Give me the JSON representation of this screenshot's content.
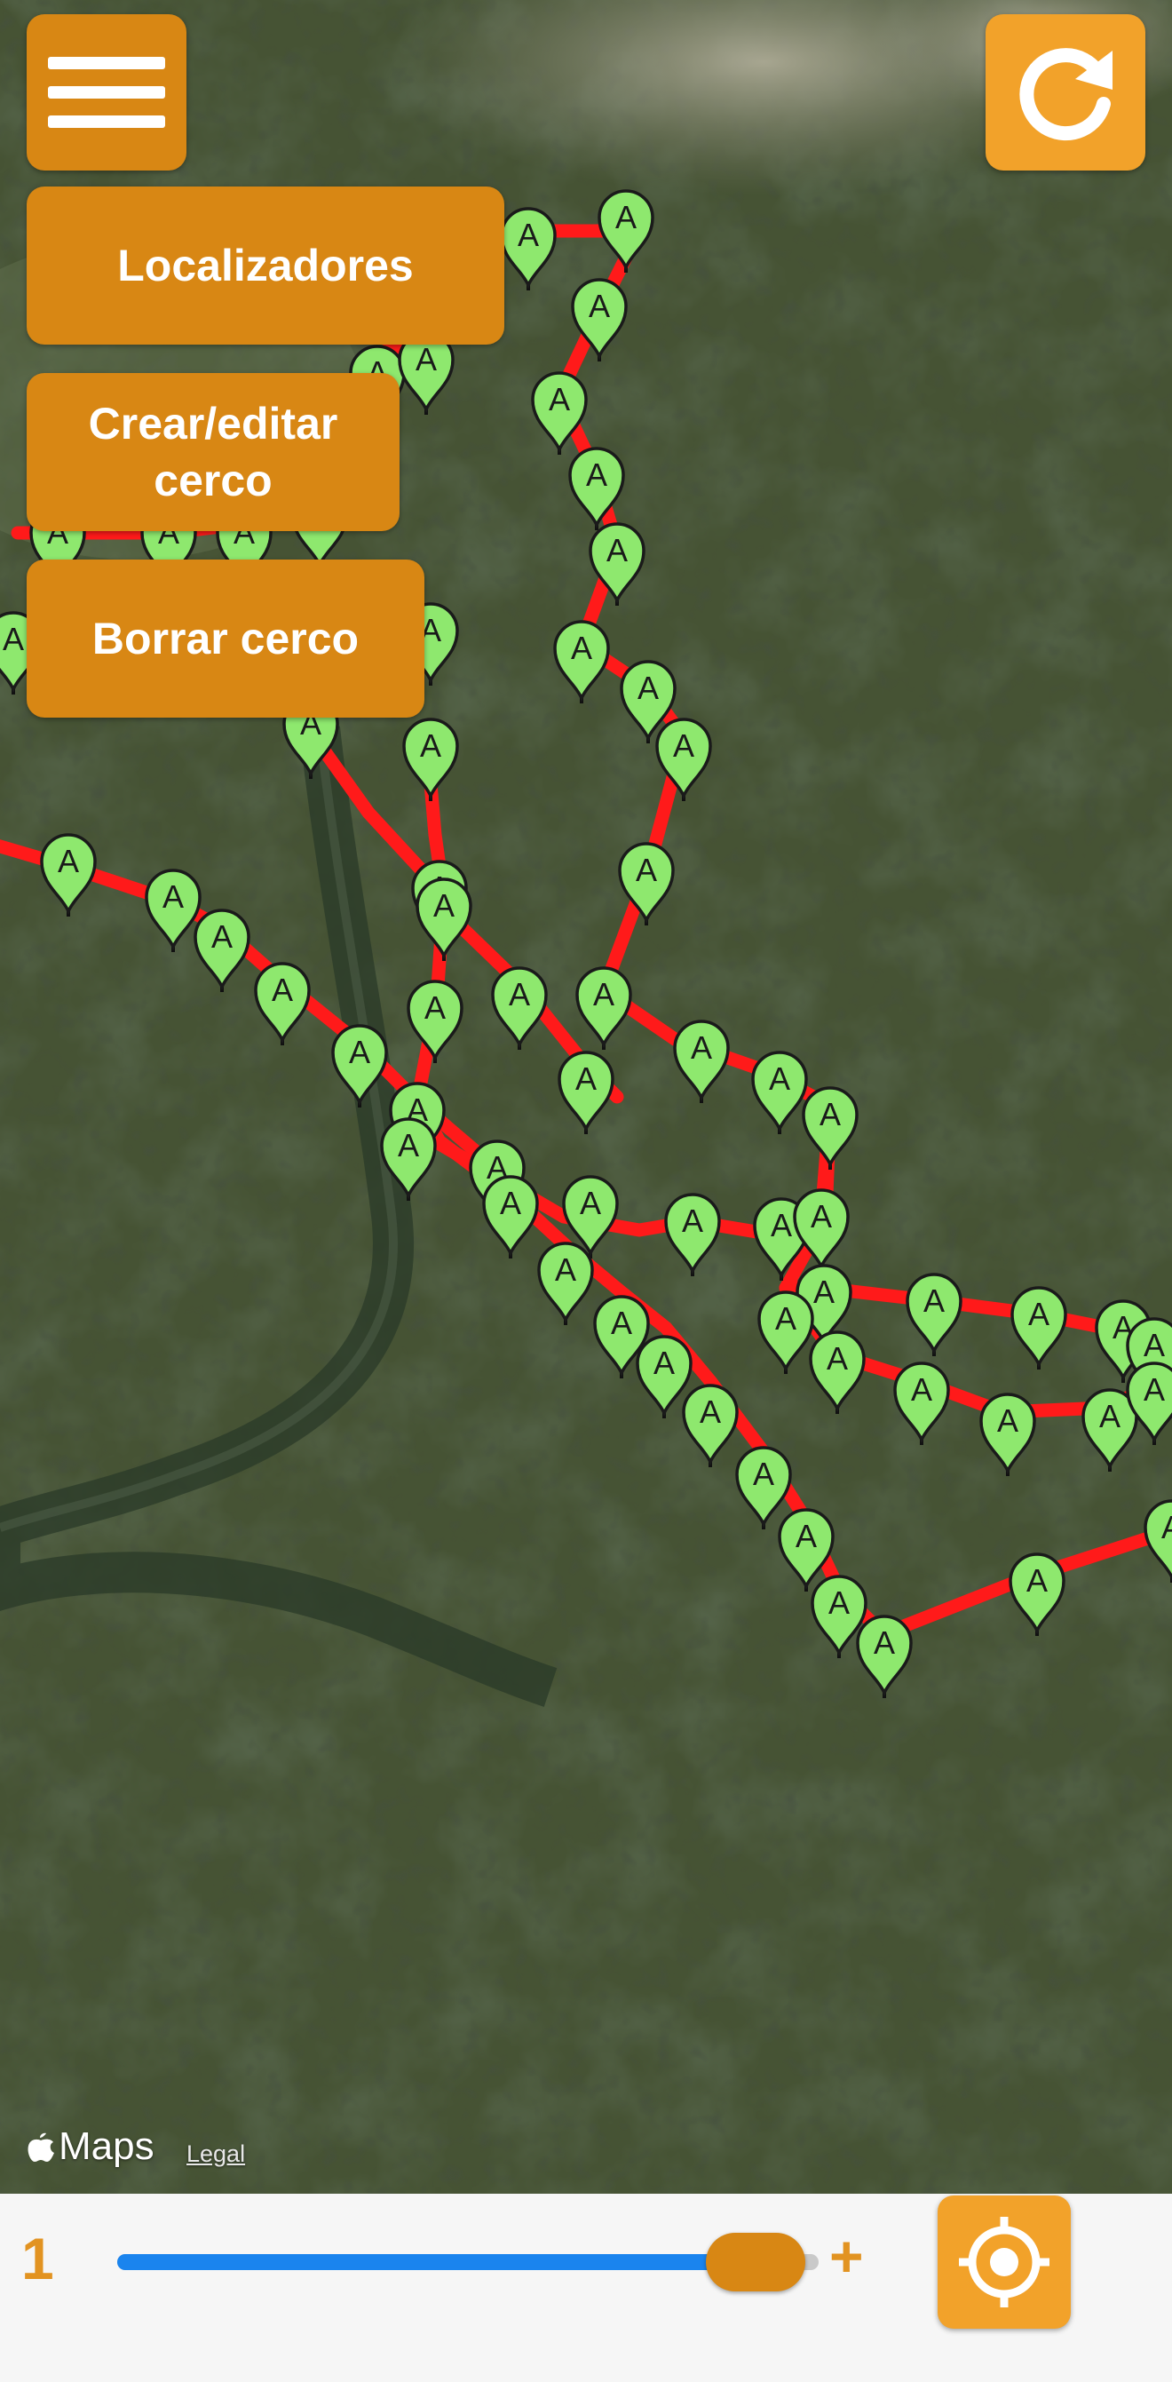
{
  "map": {
    "imagery": "satellite",
    "route_color": "#ff1a1a",
    "marker_color": "#8ee86e",
    "marker_label": "A",
    "attribution_logo": "Maps",
    "attribution_logo_icon": "apple-logo-icon",
    "legal_label": "Legal"
  },
  "menu_button": {
    "icon": "hamburger-menu-icon"
  },
  "refresh_button": {
    "icon": "refresh-icon"
  },
  "menu": {
    "localizadores_label": "Localizadores",
    "crear_editar_line1": "Crear/editar",
    "crear_editar_line2": "cerco",
    "borrar_label": "Borrar cerco"
  },
  "zoom": {
    "min_label": "1",
    "max_label": "+",
    "level": 0.91
  },
  "locate_button": {
    "icon": "crosshair-locate-icon"
  },
  "colors": {
    "accent": "#d88714",
    "accent_light": "#f2a22a",
    "slider_fill": "#1a84ee"
  }
}
